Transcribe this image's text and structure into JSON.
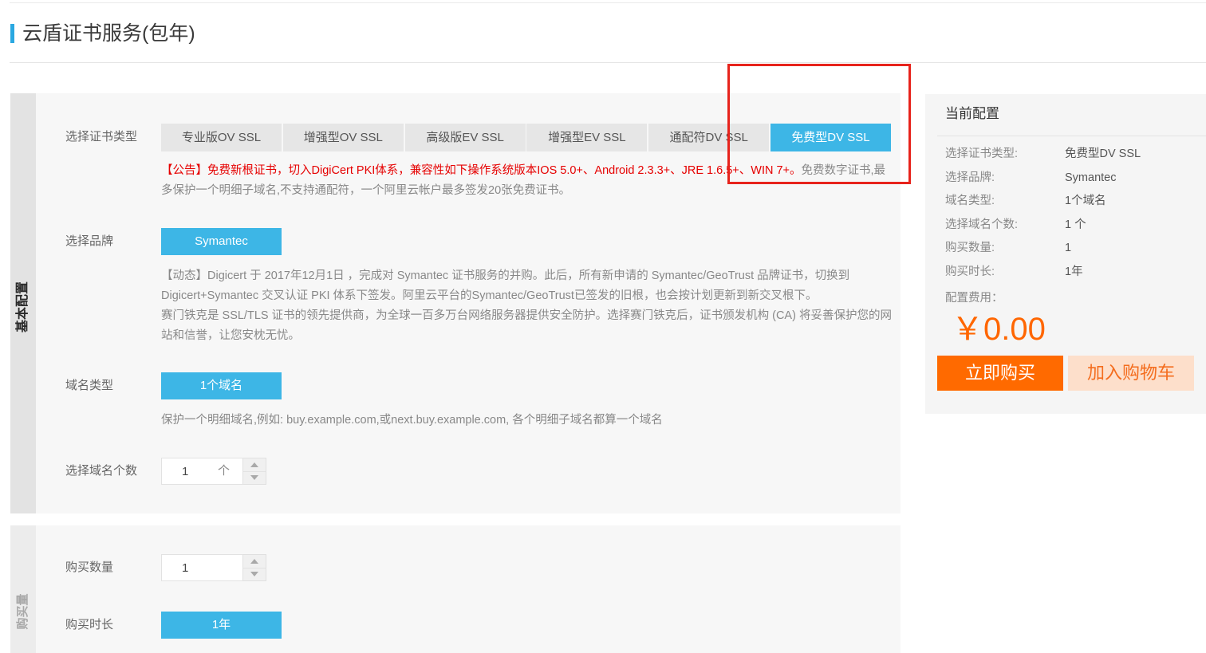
{
  "page": {
    "title": "云盾证书服务(包年)"
  },
  "colors": {
    "accent": "#3db6e6",
    "orange": "#ff6600",
    "notice_red": "#e60000",
    "annotation": "#e7231c"
  },
  "icons": {
    "increment": "triangle-up-icon",
    "decrement": "triangle-down-icon"
  },
  "basic_config": {
    "tab_label": "基本配置",
    "cert_type": {
      "label": "选择证书类型",
      "options": [
        "专业版OV SSL",
        "增强型OV SSL",
        "高级版EV SSL",
        "增强型EV SSL",
        "通配符DV SSL",
        "免费型DV SSL"
      ],
      "selected_index": 5,
      "notice_red": "【公告】免费新根证书，切入DigiCert PKI体系，兼容性如下操作系统版本IOS 5.0+、Android 2.3.3+、JRE 1.6.5+、WIN 7+。",
      "notice_gray": "免费数字证书,最多保护一个明细子域名,不支持通配符，一个阿里云帐户最多签发20张免费证书。"
    },
    "brand": {
      "label": "选择品牌",
      "options": [
        "Symantec"
      ],
      "selected_index": 0,
      "desc_news": "【动态】Digicert 于 2017年12月1日 ，完成对 Symantec 证书服务的并购。此后，所有新申请的 Symantec/GeoTrust 品牌证书，切换到 Digicert+Symantec 交叉认证 PKI 体系下签发。阿里云平台的Symantec/GeoTrust已签发的旧根，也会按计划更新到新交叉根下。",
      "desc_intro": "赛门铁克是 SSL/TLS 证书的领先提供商，为全球一百多万台网络服务器提供安全防护。选择赛门铁克后，证书颁发机构 (CA) 将妥善保护您的网站和信誉，让您安枕无忧。"
    },
    "domain_type": {
      "label": "域名类型",
      "options": [
        "1个域名"
      ],
      "selected_index": 0,
      "desc": "保护一个明细域名,例如: buy.example.com,或next.buy.example.com, 各个明细子域名都算一个域名"
    },
    "domain_count": {
      "label": "选择域名个数",
      "value": "1",
      "unit": "个"
    }
  },
  "purchase": {
    "tab_label": "购买量",
    "quantity": {
      "label": "购买数量",
      "value": "1"
    },
    "duration": {
      "label": "购买时长",
      "options": [
        "1年"
      ],
      "selected_index": 0
    }
  },
  "summary": {
    "title": "当前配置",
    "rows": [
      {
        "label": "选择证书类型:",
        "value": "免费型DV SSL"
      },
      {
        "label": "选择品牌:",
        "value": "Symantec"
      },
      {
        "label": "域名类型:",
        "value": "1个域名"
      },
      {
        "label": "选择域名个数:",
        "value": "1 个"
      },
      {
        "label": "购买数量:",
        "value": "1"
      },
      {
        "label": "购买时长:",
        "value": "1年"
      }
    ],
    "fee_label": "配置费用：",
    "price": "￥0.00",
    "buy_label": "立即购买",
    "cart_label": "加入购物车"
  }
}
